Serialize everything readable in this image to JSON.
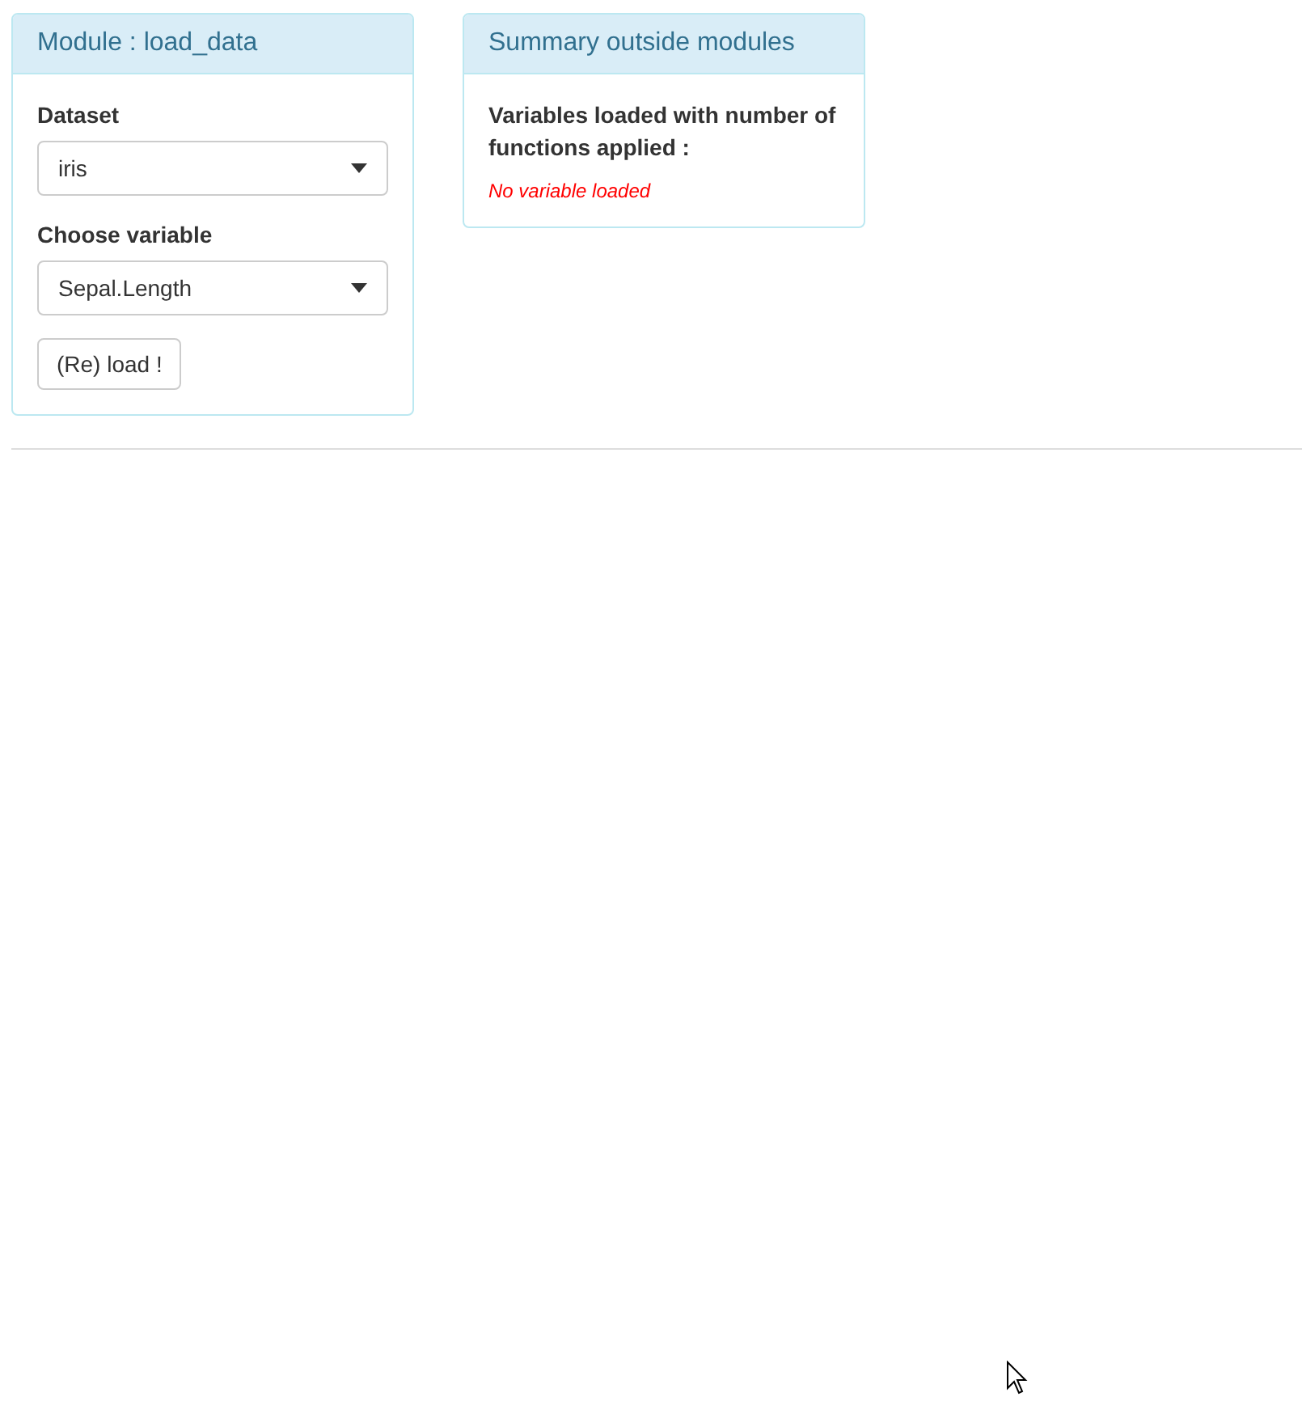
{
  "panels": [
    {
      "title": "Module : load_data",
      "items": [
        {
          "kind": "select",
          "label": "Dataset",
          "value": "iris"
        },
        {
          "kind": "select",
          "label": "Choose variable",
          "value": "Sepal.Length"
        },
        {
          "kind": "button",
          "label": "(Re) load !"
        }
      ]
    },
    {
      "title": "Summary outside modules",
      "items": [
        {
          "kind": "heading",
          "label": "Variables loaded with number of functions applied :"
        },
        {
          "kind": "message",
          "label": "No variable loaded"
        }
      ]
    }
  ]
}
